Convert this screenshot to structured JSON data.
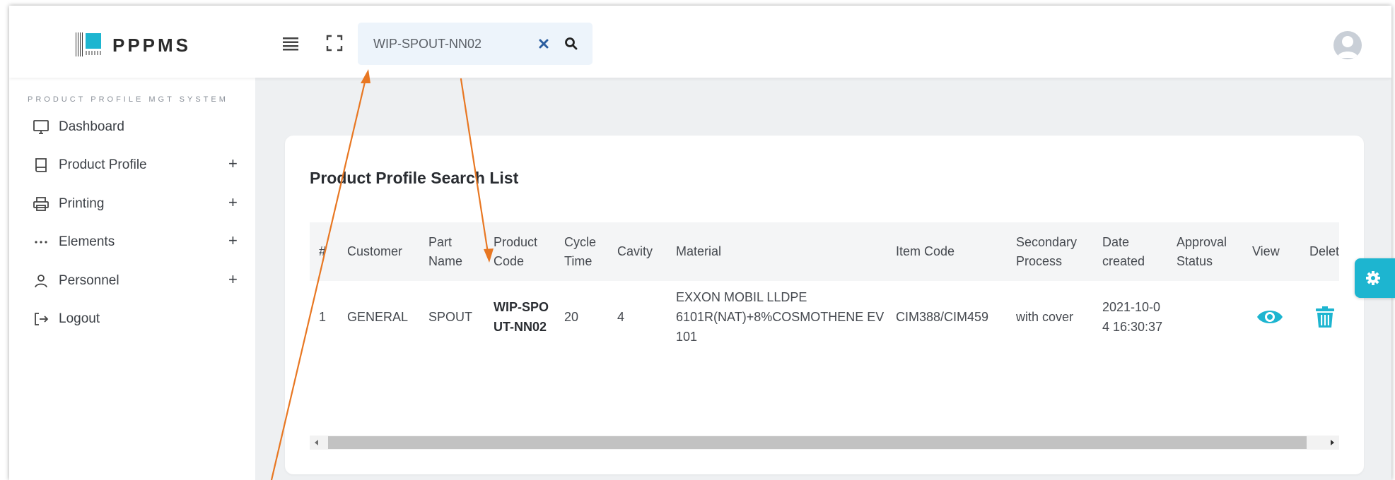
{
  "app": {
    "name": "PPPMS",
    "caption": "PRODUCT PROFILE MGT SYSTEM"
  },
  "search": {
    "value": "WIP-SPOUT-NN02"
  },
  "sidebar": {
    "items": [
      {
        "label": "Dashboard",
        "icon": "monitor-icon",
        "expandable": false
      },
      {
        "label": "Product Profile",
        "icon": "book-icon",
        "expandable": true
      },
      {
        "label": "Printing",
        "icon": "printer-icon",
        "expandable": true
      },
      {
        "label": "Elements",
        "icon": "ellipsis-icon",
        "expandable": true
      },
      {
        "label": "Personnel",
        "icon": "user-icon",
        "expandable": true
      },
      {
        "label": "Logout",
        "icon": "logout-icon",
        "expandable": false
      }
    ],
    "expand_symbol": "+"
  },
  "main": {
    "card_title": "Product Profile Search List",
    "table": {
      "headers": [
        "#",
        "Customer",
        "Part Name",
        "Product Code",
        "Cycle Time",
        "Cavity",
        "Material",
        "Item Code",
        "Secondary Process",
        "Date created",
        "Approval Status",
        "View",
        "Delete"
      ],
      "rows": [
        {
          "num": "1",
          "customer": "GENERAL",
          "part_name": "SPOUT",
          "product_code": "WIP-SPOUT-NN02",
          "cycle_time": "20",
          "cavity": "4",
          "material": "EXXON MOBIL LLDPE 6101R(NAT)+8%COSMOTHENE EV 101",
          "item_code": "CIM388/CIM459",
          "secondary_process": "with cover",
          "date_created": "2021-10-04 16:30:37",
          "approval_status": ""
        }
      ]
    }
  },
  "colors": {
    "accent": "#1db5d0",
    "annotation_arrow": "#e87722",
    "page_background": "#eef0f2",
    "search_background": "#edf4fb"
  }
}
